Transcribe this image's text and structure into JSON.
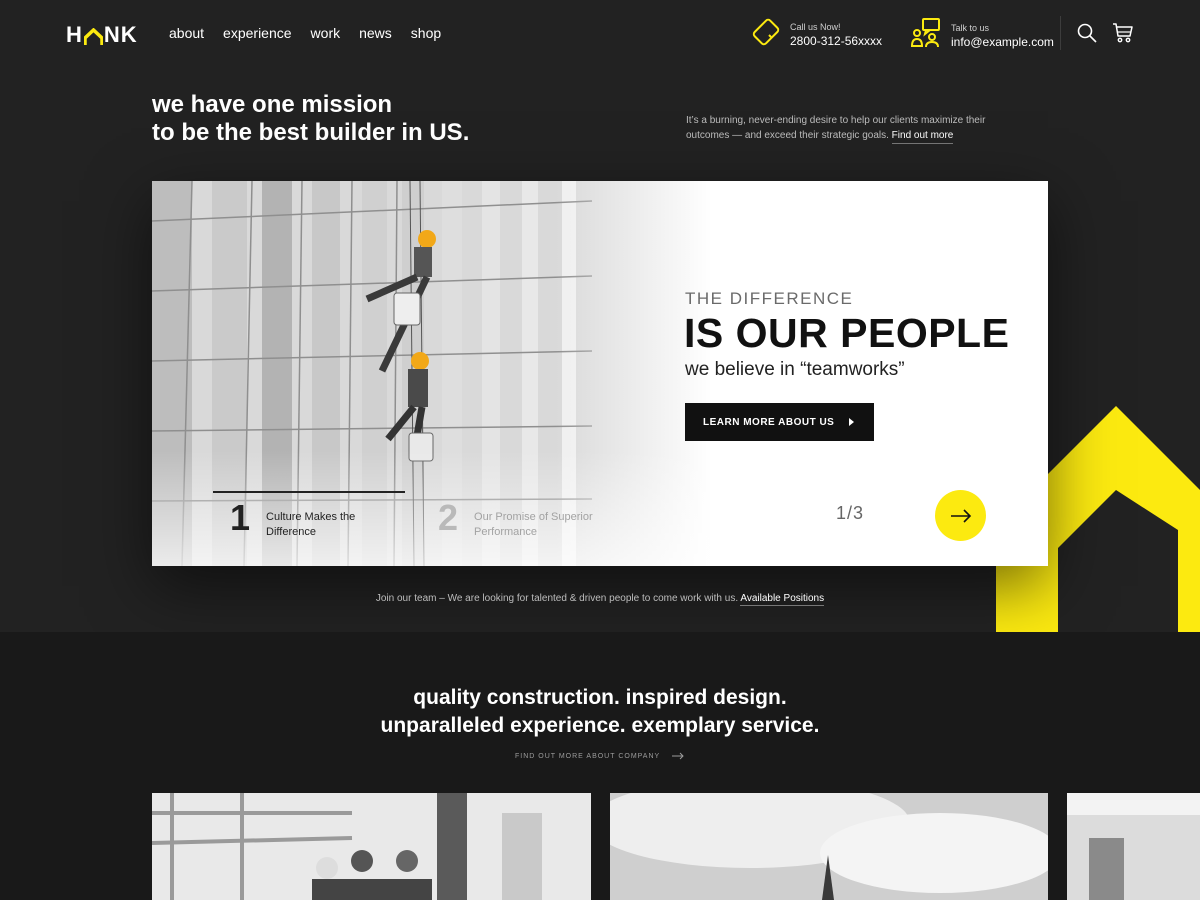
{
  "brand": {
    "logo_pre": "H",
    "logo_post": "NK",
    "accent": "#fcea10"
  },
  "nav": {
    "items": [
      {
        "label": "about"
      },
      {
        "label": "experience"
      },
      {
        "label": "work"
      },
      {
        "label": "news"
      },
      {
        "label": "shop"
      }
    ]
  },
  "contact": {
    "phone": {
      "caption": "Call us Now!",
      "value": "2800-312-56xxxx",
      "icon": "phone-icon"
    },
    "email": {
      "caption": "Talk to us",
      "value": "info@example.com",
      "icon": "chat-users-icon"
    }
  },
  "header_icons": {
    "search": "search-icon",
    "cart": "cart-icon"
  },
  "intro": {
    "line1": "we have one mission",
    "line2": "to be the best builder in US.",
    "description": "It’s a burning, never-ending desire to help our clients maximize their outcomes — and exceed their strategic goals.",
    "link": "Find out more"
  },
  "slider": {
    "eyebrow": "THE DIFFERENCE",
    "headline": "IS OUR PEOPLE",
    "tagline": "we believe in “teamworks”",
    "cta": "LEARN MORE ABOUT US",
    "pager": "1/3",
    "steps": [
      {
        "num": "1",
        "label": "Culture Makes the Difference",
        "active": true
      },
      {
        "num": "2",
        "label": "Our Promise of Superior Performance",
        "active": false
      }
    ]
  },
  "join": {
    "text": "Join our team – We are looking for talented & driven people to come work with us.",
    "link": "Available Positions"
  },
  "quality": {
    "line1": "quality construction. inspired design.",
    "line2": "unparalleled experience. exemplary service.",
    "link": "FIND OUT MORE ABOUT COMPANY"
  }
}
